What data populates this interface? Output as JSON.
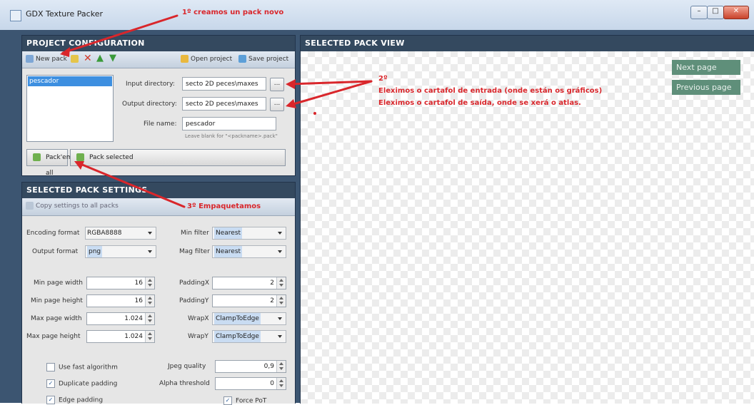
{
  "window": {
    "title": "GDX Texture Packer",
    "minimize_glyph": "–",
    "maximize_glyph": "□",
    "close_glyph": "✕"
  },
  "project": {
    "header": "PROJECT CONFIGURATION",
    "toolbar": {
      "new_pack": "New pack",
      "open_project": "Open project",
      "save_project": "Save project"
    },
    "packs": [
      "pescador"
    ],
    "input_label": "Input directory:",
    "input_value": "secto 2D peces\\maxes",
    "output_label": "Output directory:",
    "output_value": "secto 2D peces\\maxes",
    "browse_label": "...",
    "filename_label": "File name:",
    "filename_value": "pescador",
    "filename_hint": "Leave blank for \"<packname>.pack\"",
    "pack_all": "Pack'em all",
    "pack_selected": "Pack selected"
  },
  "settings": {
    "header": "SELECTED PACK SETTINGS",
    "copy_to_all": "Copy settings to all packs",
    "encoding_label": "Encoding format",
    "encoding_value": "RGBA8888",
    "output_format_label": "Output format",
    "output_format_value": "png",
    "min_filter_label": "Min filter",
    "min_filter_value": "Nearest",
    "mag_filter_label": "Mag filter",
    "mag_filter_value": "Nearest",
    "min_page_width_label": "Min page width",
    "min_page_width": "16",
    "min_page_height_label": "Min page height",
    "min_page_height": "16",
    "max_page_width_label": "Max page width",
    "max_page_width": "1.024",
    "max_page_height_label": "Max page height",
    "max_page_height": "1.024",
    "paddingx_label": "PaddingX",
    "paddingx": "2",
    "paddingy_label": "PaddingY",
    "paddingy": "2",
    "wrapx_label": "WrapX",
    "wrapx_value": "ClampToEdge",
    "wrapy_label": "WrapY",
    "wrapy_value": "ClampToEdge",
    "fast_algo": "Use fast algorithm",
    "dup_padding": "Duplicate padding",
    "edge_padding": "Edge padding",
    "jpeg_label": "Jpeg quality",
    "jpeg_value": "0,9",
    "alpha_label": "Alpha threshold",
    "alpha_value": "0",
    "force_pot": "Force PoT"
  },
  "view": {
    "header": "SELECTED PACK VIEW",
    "next_page": "Next page",
    "previous_page": "Previous page"
  },
  "annotations": {
    "step1": "1º creamos un pack novo",
    "step2_num": "2º",
    "step2_line1": "Eleximos o cartafol de entrada (onde están os gráficos)",
    "step2_line2": "Eleximos o cartafol de saída, onde se xerá o atlas.",
    "step3": "3º Empaquetamos"
  },
  "colors": {
    "accent_red": "#d9262b",
    "panel_head": "#34495f",
    "selection": "#3d8fe0",
    "page_button": "#5f8f7a"
  }
}
